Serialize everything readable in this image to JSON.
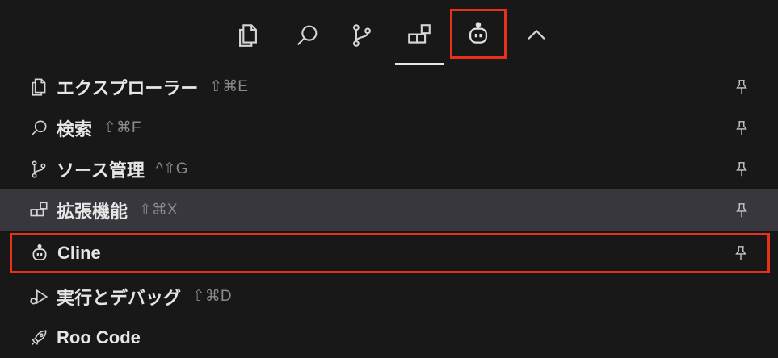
{
  "activity_bar": {
    "icons": [
      {
        "name": "explorer-icon"
      },
      {
        "name": "search-icon"
      },
      {
        "name": "source-control-icon"
      },
      {
        "name": "extensions-icon",
        "active": true
      },
      {
        "name": "cline-robot-icon",
        "highlighted": true
      },
      {
        "name": "chevron-up-icon"
      }
    ]
  },
  "menu": {
    "items": [
      {
        "label": "エクスプローラー",
        "shortcut": "⇧⌘E",
        "icon": "files-icon",
        "pinned": true
      },
      {
        "label": "検索",
        "shortcut": "⇧⌘F",
        "icon": "search-icon",
        "pinned": true
      },
      {
        "label": "ソース管理",
        "shortcut": "^⇧G",
        "icon": "source-control-icon",
        "pinned": true
      },
      {
        "label": "拡張機能",
        "shortcut": "⇧⌘X",
        "icon": "extensions-icon",
        "pinned": true,
        "hovered": true
      },
      {
        "label": "Cline",
        "shortcut": "",
        "icon": "cline-robot-icon",
        "pinned": true,
        "highlighted": true
      },
      {
        "label": "実行とデバッグ",
        "shortcut": "⇧⌘D",
        "icon": "run-debug-icon",
        "pinned": false
      },
      {
        "label": "Roo Code",
        "shortcut": "",
        "icon": "rocket-icon",
        "pinned": false
      }
    ]
  },
  "colors": {
    "background": "#181818",
    "hover": "#37373d",
    "highlight": "#e8311a",
    "text": "#e6e6e6",
    "shortcut": "#8b8b8b"
  }
}
